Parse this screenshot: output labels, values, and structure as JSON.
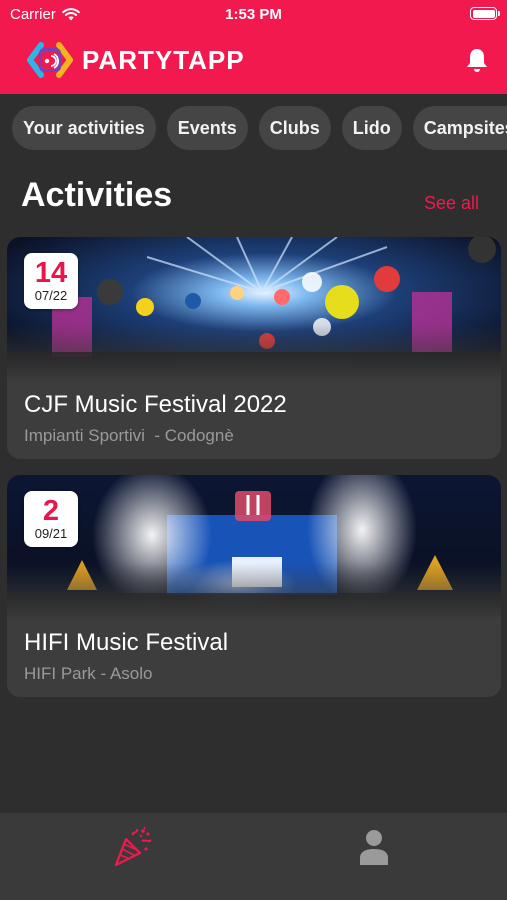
{
  "status_bar": {
    "carrier": "Carrier",
    "time": "1:53 PM"
  },
  "header": {
    "app_name": "PARTYTAPP",
    "brand_color": "#f2194f",
    "notification_icon": "bell-icon"
  },
  "categories": [
    "Your activities",
    "Events",
    "Clubs",
    "Lido",
    "Campsites"
  ],
  "section": {
    "title": "Activities",
    "see_all": "See all"
  },
  "activities": [
    {
      "day": "14",
      "month": "07/22",
      "title": "CJF Music Festival 2022",
      "place": "Impianti Sportivi  - Codognè"
    },
    {
      "day": "2",
      "month": "09/21",
      "title": "HIFI Music Festival",
      "place": "HIFI Park - Asolo"
    }
  ],
  "tab_bar": {
    "items": [
      {
        "icon": "party-popper-icon",
        "active": true
      },
      {
        "icon": "user-icon",
        "active": false
      }
    ]
  }
}
